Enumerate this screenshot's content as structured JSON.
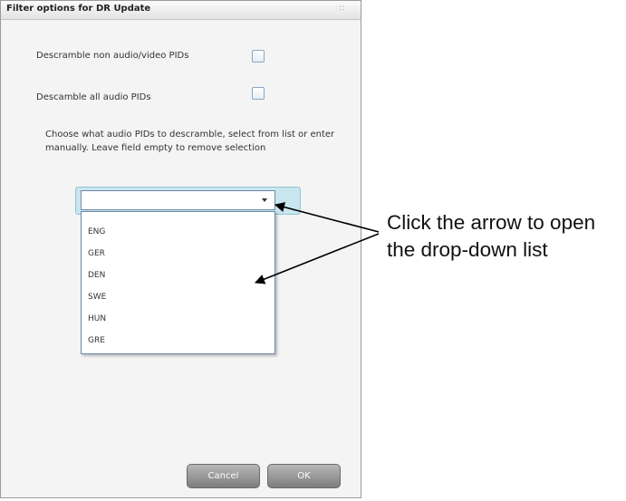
{
  "dialog": {
    "title": "Filter options for DR Update",
    "close_icon": "close-icon",
    "option1_label": "Descramble non audio/video PIDs",
    "option2_label": "Descamble all audio PIDs",
    "instructions": "Choose what audio PIDs to descramble, select from list or enter manually. Leave field empty to remove selection",
    "combo_value": "",
    "dropdown_icon": "chevron-down-icon",
    "list_items": [
      "ENG",
      "GER",
      "DEN",
      "SWE",
      "HUN",
      "GRE"
    ],
    "cancel_label": "Cancel",
    "ok_label": "OK"
  },
  "annotation": {
    "text": "Click the arrow to open the drop-down list"
  }
}
